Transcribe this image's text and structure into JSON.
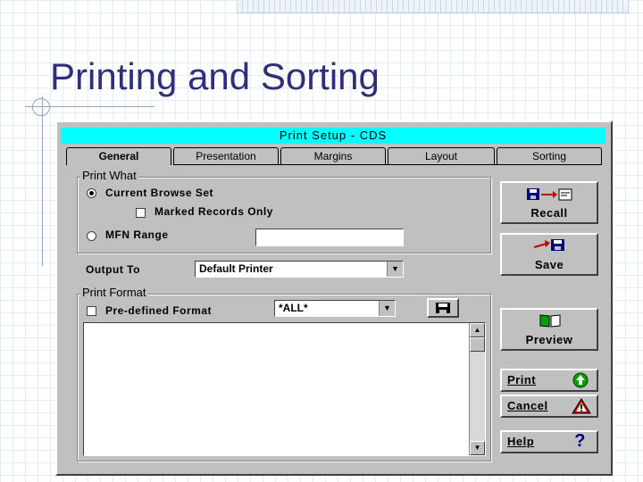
{
  "slide": {
    "title": "Printing and Sorting"
  },
  "dialog": {
    "title": "Print Setup - CDS",
    "tabs": [
      {
        "label": "General",
        "active": true
      },
      {
        "label": "Presentation",
        "active": false
      },
      {
        "label": "Margins",
        "active": false
      },
      {
        "label": "Layout",
        "active": false
      },
      {
        "label": "Sorting",
        "active": false
      }
    ],
    "print_what": {
      "group_label": "Print What",
      "current_browse_set": "Current Browse Set",
      "marked_records_only": "Marked Records Only",
      "mfn_range": "MFN Range",
      "mfn_range_value": ""
    },
    "output": {
      "label": "Output To",
      "value": "Default Printer"
    },
    "print_format": {
      "group_label": "Print Format",
      "predefined_label": "Pre-defined Format",
      "format_value": "*ALL*"
    },
    "buttons": {
      "recall": "Recall",
      "save": "Save",
      "preview": "Preview",
      "print": "Print",
      "cancel": "Cancel",
      "help": "Help"
    }
  },
  "colors": {
    "titlebar": "#00ffff",
    "dialog_bg": "#c0c0c0",
    "slide_title": "#2e2e7a"
  }
}
